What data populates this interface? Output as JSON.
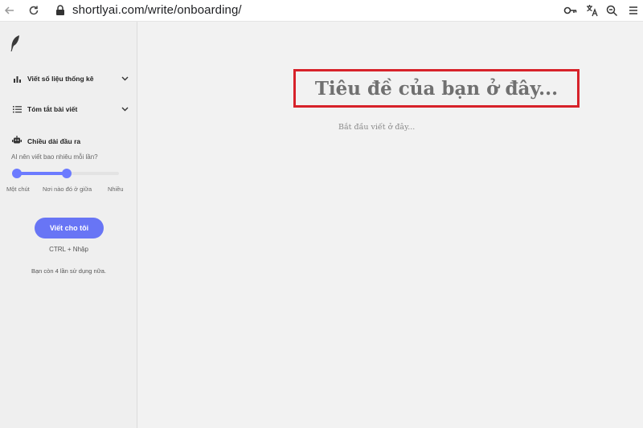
{
  "browser": {
    "url": "shortlyai.com/write/onboarding/",
    "icons": [
      "back-arrow-icon",
      "reload-icon",
      "lock-icon",
      "key-icon",
      "translate-icon",
      "zoom-icon",
      "menu-icon"
    ]
  },
  "sidebar": {
    "logo_icon": "feather-icon",
    "menu": [
      {
        "label": "Viết số liệu thống kê",
        "icon": "bar-chart-icon"
      },
      {
        "label": "Tóm tắt bài viết",
        "icon": "list-icon"
      }
    ],
    "output_length": {
      "title": "Chiều dài đầu ra",
      "icon": "robot-icon",
      "question": "AI nên viết bao nhiêu mỗi lần?",
      "ticks": [
        "Một chút",
        "Nơi nào đó ở giữa",
        "Nhiều"
      ],
      "range_start": 0.0,
      "range_end": 0.5
    },
    "write_button": "Viết cho tôi",
    "shortcut": "CTRL + Nhập",
    "remaining": "Bạn còn 4 lần sử dụng nữa."
  },
  "editor": {
    "title_placeholder": "Tiêu đề của bạn ở đây...",
    "body_placeholder": "Bắt đầu viết ở đây..."
  },
  "colors": {
    "accent": "#6875f5",
    "highlight_border": "#d7222a"
  }
}
